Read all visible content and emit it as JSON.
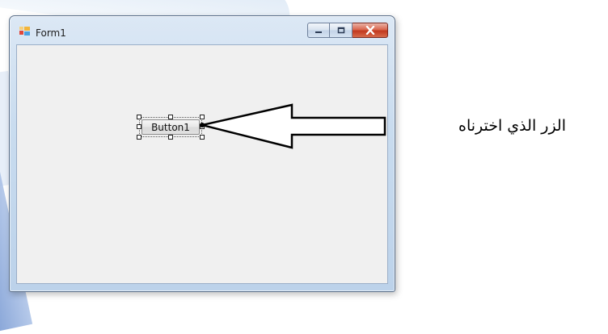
{
  "window": {
    "title": "Form1",
    "icon": "form-app-icon",
    "caption_buttons": [
      "minimize-icon",
      "maximize-icon",
      "close-icon"
    ]
  },
  "form": {
    "button_label": "Button1"
  },
  "annotation": {
    "text": "الزر الذي اخترناه"
  },
  "colors": {
    "close_button": "#c2391e",
    "client_bg": "#f0f0f0",
    "frame": "#bcd2ea"
  }
}
